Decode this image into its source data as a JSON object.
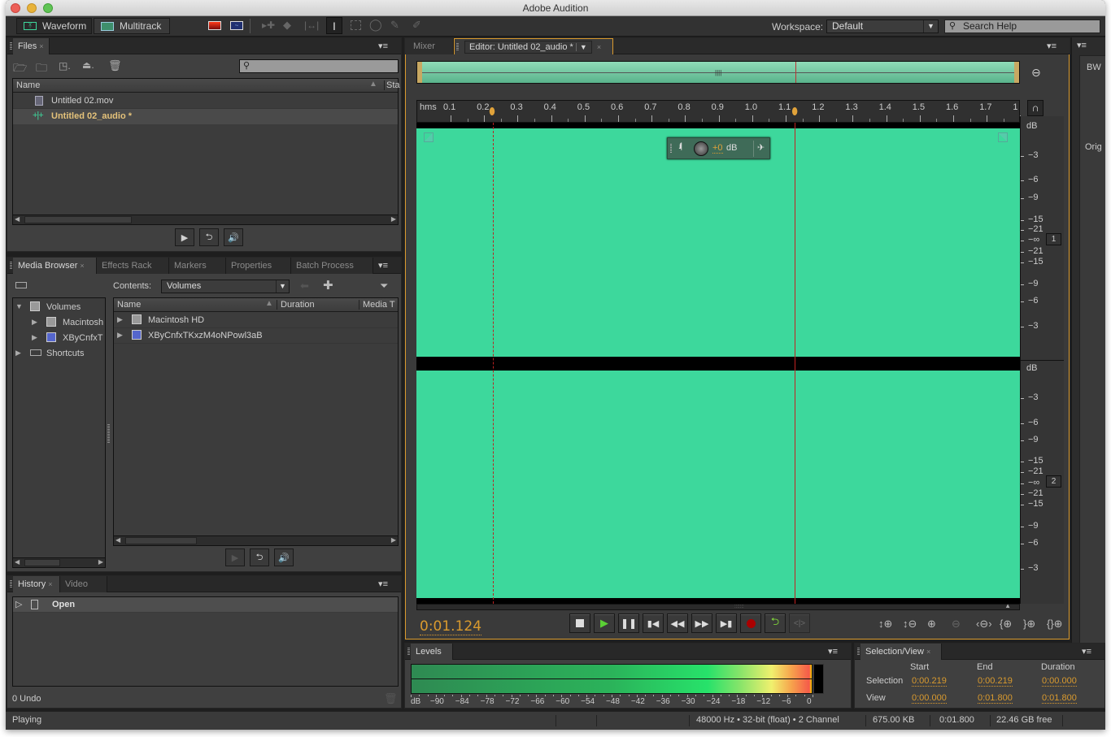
{
  "window": {
    "title": "Adobe Audition"
  },
  "toolbar": {
    "waveform_label": "Waveform",
    "multitrack_label": "Multitrack",
    "workspace_label": "Workspace:",
    "workspace_value": "Default",
    "search_placeholder": "Search Help",
    "tools": [
      "spectral-frequency-display-icon",
      "spectral-pitch-display-icon",
      "move-tool-icon",
      "razor-tool-icon",
      "slip-tool-icon",
      "time-selection-tool-icon",
      "marquee-selection-tool-icon",
      "lasso-selection-tool-icon",
      "paintbrush-selection-tool-icon",
      "spot-healing-brush-icon"
    ]
  },
  "files_panel": {
    "tab_label": "Files",
    "column_name": "Name",
    "column_status": "Sta",
    "items": [
      {
        "name": "Untitled 02.mov",
        "icon": "video-file-icon",
        "selected": false
      },
      {
        "name": "Untitled 02_audio *",
        "icon": "audio-waveform-icon",
        "selected": true
      }
    ]
  },
  "media_panel": {
    "tabs": [
      "Media Browser",
      "Effects Rack",
      "Markers",
      "Properties",
      "Batch Process"
    ],
    "contents_label": "Contents:",
    "contents_value": "Volumes",
    "tree": [
      {
        "label": "Volumes",
        "expanded": true,
        "level": 0
      },
      {
        "label": "Macintosh",
        "expanded": false,
        "level": 1
      },
      {
        "label": "XByCnfxT",
        "expanded": false,
        "level": 1
      },
      {
        "label": "Shortcuts",
        "expanded": false,
        "level": 0
      }
    ],
    "columns": [
      "Name",
      "Duration",
      "Media T"
    ],
    "rows": [
      {
        "name": "Macintosh HD"
      },
      {
        "name": "XByCnfxTKxzM4oNPowl3aB"
      }
    ]
  },
  "history_panel": {
    "tabs": [
      "History",
      "Video"
    ],
    "items": [
      {
        "label": "Open"
      }
    ],
    "undo_count": "0 Undo"
  },
  "editor": {
    "tabs": [
      "Mixer",
      "Editor: Untitled 02_audio *"
    ],
    "ruler_unit": "hms",
    "ruler_ticks": [
      "0.1",
      "0.2",
      "0.3",
      "0.4",
      "0.5",
      "0.6",
      "0.7",
      "0.8",
      "0.9",
      "1.0",
      "1.1",
      "1.2",
      "1.3",
      "1.4",
      "1.5",
      "1.6",
      "1.7",
      "1"
    ],
    "db_ticks_ch1": [
      "dB",
      "-3",
      "-6",
      "-9",
      "-15",
      "-21",
      "-∞",
      "-21",
      "-15",
      "-9",
      "-6",
      "-3"
    ],
    "db_ticks_ch2": [
      "dB",
      "-3",
      "-6",
      "-9",
      "-15",
      "-21",
      "-∞",
      "-21",
      "-15",
      "-9",
      "-6",
      "-3"
    ],
    "channel_labels": [
      "1",
      "2"
    ],
    "hud_gain": "+0",
    "hud_unit": "dB",
    "current_time": "0:01.124",
    "selection_start_sec": 0.219,
    "playhead_sec": 1.124,
    "view_end_sec": 1.8,
    "waveform_color": "#3dd89c"
  },
  "transport": [
    "stop",
    "play",
    "pause",
    "move-to-previous",
    "rewind",
    "fast-forward",
    "move-to-next",
    "record",
    "loop-playback",
    "skip-selection"
  ],
  "zoom_controls": [
    "zoom-in-amplitude",
    "zoom-out-amplitude",
    "zoom-in-time",
    "zoom-out-time",
    "zoom-out-full",
    "zoom-in-at-in-point",
    "zoom-in-at-out-point",
    "zoom-to-selection"
  ],
  "levels_panel": {
    "tab_label": "Levels",
    "scale": [
      "dB",
      "-90",
      "-84",
      "-78",
      "-72",
      "-66",
      "-60",
      "-54",
      "-48",
      "-42",
      "-36",
      "-30",
      "-24",
      "-18",
      "-12",
      "-6",
      "0"
    ]
  },
  "selection_view": {
    "tab_label": "Selection/View",
    "headers": [
      "Start",
      "End",
      "Duration"
    ],
    "rows": [
      {
        "label": "Selection",
        "start": "0:00.219",
        "end": "0:00.219",
        "duration": "0:00.000"
      },
      {
        "label": "View",
        "start": "0:00.000",
        "end": "0:01.800",
        "duration": "0:01.800"
      }
    ]
  },
  "right_panel": {
    "tab_label": "BW",
    "text": "Orig"
  },
  "status_bar": {
    "state": "Playing",
    "format": "48000 Hz • 32-bit (float) • 2 Channel",
    "size": "675.00 KB",
    "duration": "0:01.800",
    "free": "22.46 GB free"
  }
}
